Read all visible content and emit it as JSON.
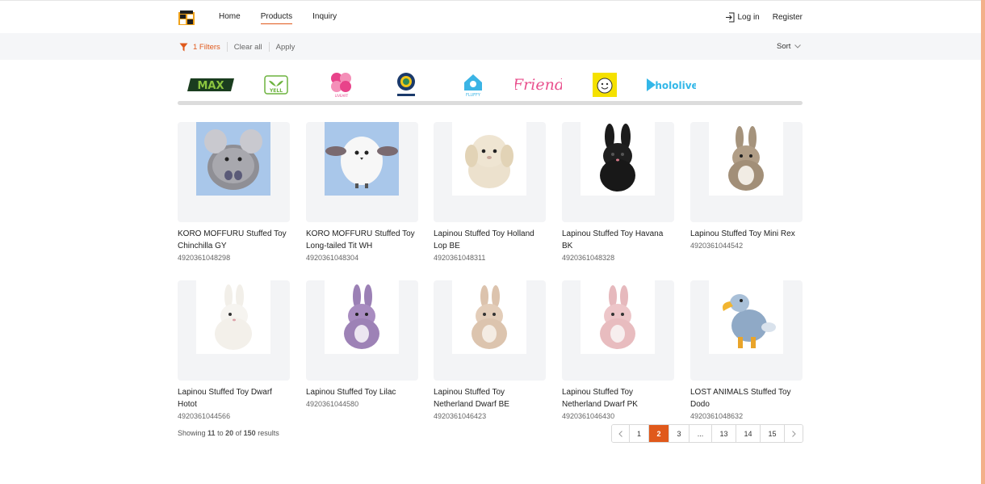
{
  "header": {
    "logo_icon": "building-logo-icon",
    "nav": [
      "Home",
      "Products",
      "Inquiry"
    ],
    "active_nav": "Products",
    "login_label": "Log in",
    "register_label": "Register"
  },
  "filters": {
    "count_label": "1 Filters",
    "clear_label": "Clear all",
    "apply_label": "Apply",
    "sort_label": "Sort"
  },
  "brands": [
    {
      "name": "MAX",
      "color": "#1d6b2a"
    },
    {
      "name": "YELL",
      "color": "#6db33f"
    },
    {
      "name": "LIVEART",
      "color": "#e8438a"
    },
    {
      "name": "emblem",
      "color": "#1b3a6b"
    },
    {
      "name": "FLUFFY House",
      "color": "#3bb4e5"
    },
    {
      "name": "Friend",
      "color": "#e9508d"
    },
    {
      "name": "smile",
      "color": "#f5e100"
    },
    {
      "name": "hololive",
      "color": "#33b7e8"
    }
  ],
  "products": [
    {
      "title": "KORO MOFFURU Stuffed Toy Chinchilla GY",
      "code": "4920361048298",
      "bg": "blue"
    },
    {
      "title": "KORO MOFFURU Stuffed Toy Long-tailed Tit WH",
      "code": "4920361048304",
      "bg": "blue"
    },
    {
      "title": "Lapinou Stuffed Toy Holland Lop BE",
      "code": "4920361048311",
      "bg": "white"
    },
    {
      "title": "Lapinou Stuffed Toy Havana BK",
      "code": "4920361048328",
      "bg": "white"
    },
    {
      "title": "Lapinou Stuffed Toy Mini Rex",
      "code": "4920361044542",
      "bg": "white"
    },
    {
      "title": "Lapinou Stuffed Toy Dwarf Hotot",
      "code": "4920361044566",
      "bg": "white"
    },
    {
      "title": "Lapinou Stuffed Toy Lilac",
      "code": "4920361044580",
      "bg": "white"
    },
    {
      "title": "Lapinou Stuffed Toy Netherland Dwarf BE",
      "code": "4920361046423",
      "bg": "white"
    },
    {
      "title": "Lapinou Stuffed Toy Netherland Dwarf PK",
      "code": "4920361046430",
      "bg": "white"
    },
    {
      "title": "LOST ANIMALS Stuffed Toy Dodo",
      "code": "4920361048632",
      "bg": "white"
    }
  ],
  "results": {
    "prefix": "Showing",
    "from": "11",
    "to_word": "to",
    "to": "20",
    "of_word": "of",
    "total": "150",
    "suffix": "results"
  },
  "pagination": {
    "pages": [
      "1",
      "2",
      "3",
      "...",
      "13",
      "14",
      "15"
    ],
    "current": "2",
    "prev_icon": "chevron-left-icon",
    "next_icon": "chevron-right-icon"
  },
  "colors": {
    "accent": "#e0591b",
    "filter_bar_bg": "#f5f6f8",
    "thumb_bg": "#f3f4f6",
    "photo_blue": "#a9c7ea"
  }
}
